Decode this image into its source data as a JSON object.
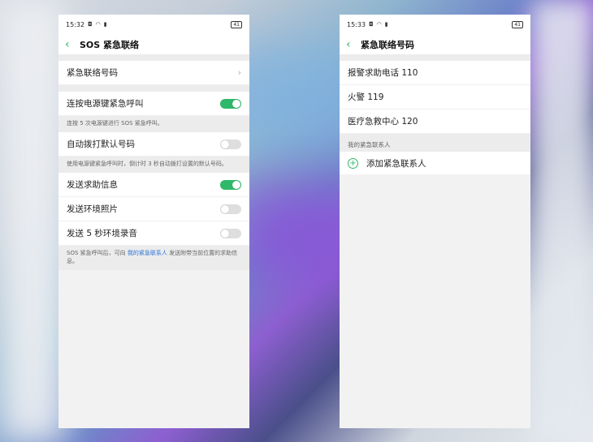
{
  "left": {
    "status": {
      "time": "15:32",
      "battery": "41"
    },
    "title": "SOS 紧急联络",
    "emergency_numbers_label": "紧急联络号码",
    "power_key_call": {
      "label": "连按电源键紧急呼叫",
      "enabled": true,
      "note": "连按 5 次电源键进行 SOS 紧急呼叫。"
    },
    "auto_dial": {
      "label": "自动拨打默认号码",
      "enabled": false,
      "note": "使用电源键紧急呼叫时，倒计时 3 秒自动拨打设置的默认号码。"
    },
    "send_help": {
      "label": "发送求助信息",
      "enabled": true
    },
    "send_photo": {
      "label": "发送环境照片",
      "enabled": false
    },
    "send_audio": {
      "label": "发送 5 秒环境录音",
      "enabled": false
    },
    "footer": {
      "prefix": "SOS 紧急呼叫后，可向 ",
      "link": "我的紧急联系人",
      "suffix": " 发送附带当前位置的求助信息。"
    }
  },
  "right": {
    "status": {
      "time": "15:33",
      "battery": "41"
    },
    "title": "紧急联络号码",
    "numbers": [
      "报警求助电话 110",
      "火警 119",
      "医疗急救中心 120"
    ],
    "my_contacts_label": "我的紧急联系人",
    "add_contact": "添加紧急联系人"
  },
  "colors": {
    "accent": "#2fb86a",
    "link": "#2a74d9"
  },
  "icons": [
    "back-arrow-icon",
    "chevron-right-icon",
    "plus-circle-icon",
    "wifi-icon",
    "battery-icon"
  ]
}
